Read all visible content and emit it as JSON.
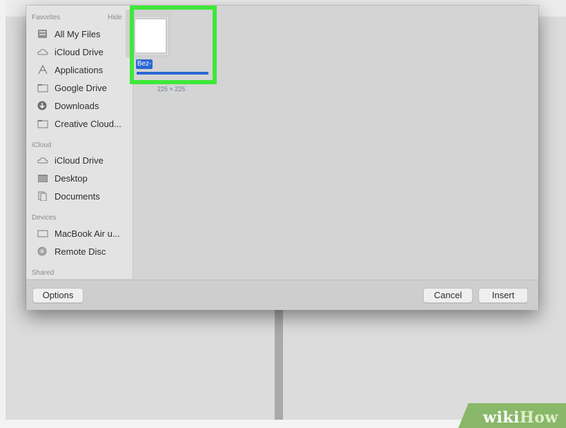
{
  "sidebar": {
    "favorites_header": "Favorites",
    "hide_label": "Hide",
    "favorites": [
      {
        "label": "All My Files",
        "icon": "all-files-icon"
      },
      {
        "label": "iCloud Drive",
        "icon": "cloud-icon"
      },
      {
        "label": "Applications",
        "icon": "applications-icon"
      },
      {
        "label": "Google Drive",
        "icon": "folder-icon"
      },
      {
        "label": "Downloads",
        "icon": "download-icon"
      },
      {
        "label": "Creative Cloud...",
        "icon": "folder-icon"
      }
    ],
    "icloud_header": "iCloud",
    "icloud": [
      {
        "label": "iCloud Drive",
        "icon": "cloud-icon"
      },
      {
        "label": "Desktop",
        "icon": "desktop-folder-icon"
      },
      {
        "label": "Documents",
        "icon": "documents-icon"
      }
    ],
    "devices_header": "Devices",
    "devices": [
      {
        "label": "MacBook Air u...",
        "icon": "laptop-icon"
      },
      {
        "label": "Remote Disc",
        "icon": "disc-icon"
      }
    ],
    "shared_header": "Shared"
  },
  "file": {
    "name": "Bez-",
    "dimensions": "225 × 225"
  },
  "buttons": {
    "options": "Options",
    "cancel": "Cancel",
    "insert": "Insert"
  },
  "watermark": {
    "part1": "wiki",
    "part2": "How"
  },
  "colors": {
    "highlight": "#3ee83a",
    "selection": "#2b67d4",
    "watermark_bg": "#8ab86a"
  }
}
